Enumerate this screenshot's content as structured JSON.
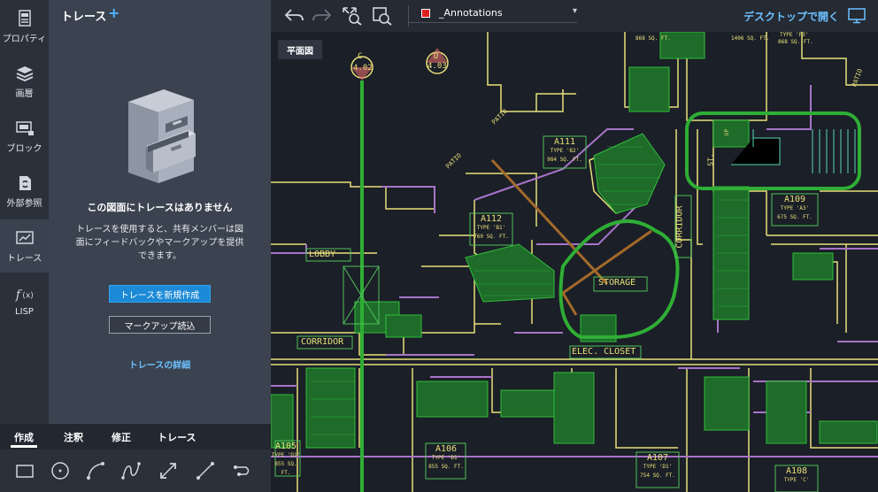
{
  "rail": {
    "items": [
      {
        "label": "プロパティ",
        "icon": "properties-icon"
      },
      {
        "label": "画層",
        "icon": "layers-icon"
      },
      {
        "label": "ブロック",
        "icon": "block-icon"
      },
      {
        "label": "外部参照",
        "icon": "xref-icon"
      },
      {
        "label": "トレース",
        "icon": "trace-icon",
        "active": true
      },
      {
        "label": "LISP",
        "icon": "lisp-icon"
      }
    ]
  },
  "panel": {
    "title": "トレース",
    "add_label": "+",
    "empty_title": "この図面にトレースはありません",
    "empty_desc": "トレースを使用すると、共有メンバーは図面にフィードバックやマークアップを提供できます。",
    "new_button": "トレースを新規作成",
    "markup_button": "マークアップ読込",
    "details_link": "トレースの詳細"
  },
  "bottom_tabs": [
    {
      "label": "作成",
      "active": true
    },
    {
      "label": "注釈"
    },
    {
      "label": "修正"
    },
    {
      "label": "トレース"
    }
  ],
  "tools": [
    "rectangle-tool-icon",
    "circle-tool-icon",
    "arc-tool-icon",
    "spline-tool-icon",
    "move-tool-icon",
    "line-tool-icon",
    "polyline-tool-icon"
  ],
  "toolbar": {
    "layer_name": "_Annotations",
    "layer_color": "#e02020",
    "desktop_link": "デスクトップで開く"
  },
  "canvas": {
    "view_label": "平面図",
    "labels": {
      "c_id": "C",
      "c_num": "4.02",
      "d_id": "D",
      "d_num": "4.03",
      "patio1": "PATIO",
      "patio2": "PATIO",
      "patio3": "PATIO",
      "a111": "A111",
      "a111_type": "TYPE 'B2'",
      "a111_area": "984 SQ. FT.",
      "a112": "A112",
      "a112_type": "TYPE 'B1'",
      "a112_area": "760 SQ. FT.",
      "a109": "A109",
      "a109_type": "TYPE 'A3'",
      "a109_area": "675 SQ. FT.",
      "a106": "A106",
      "a106_type": "TYPE 'D1'",
      "a106_area": "855 SQ. FT.",
      "a107": "A107",
      "a107_type": "TYPE 'D1'",
      "a107_area": "754 SQ. FT.",
      "a108": "A108",
      "a108_type": "TYPE 'C'",
      "a108_area": "",
      "a105": "A105",
      "a105_type": "TYPE 'D1'",
      "a105_area": "855 SQ. FT.",
      "top1_area": "868 SQ. FT.",
      "top2_area": "1406 SQ. FT.",
      "top3_type": "TYPE 'F3'",
      "top3_area": "868 SQ. FT.",
      "lobby": "LOBBY",
      "storage": "STORAGE",
      "corridor_h": "CORRIDOR",
      "corridor_v": "CORRIDOR",
      "elec": "ELEC. CLOSET",
      "st": "ST.",
      "up": "UP"
    }
  }
}
